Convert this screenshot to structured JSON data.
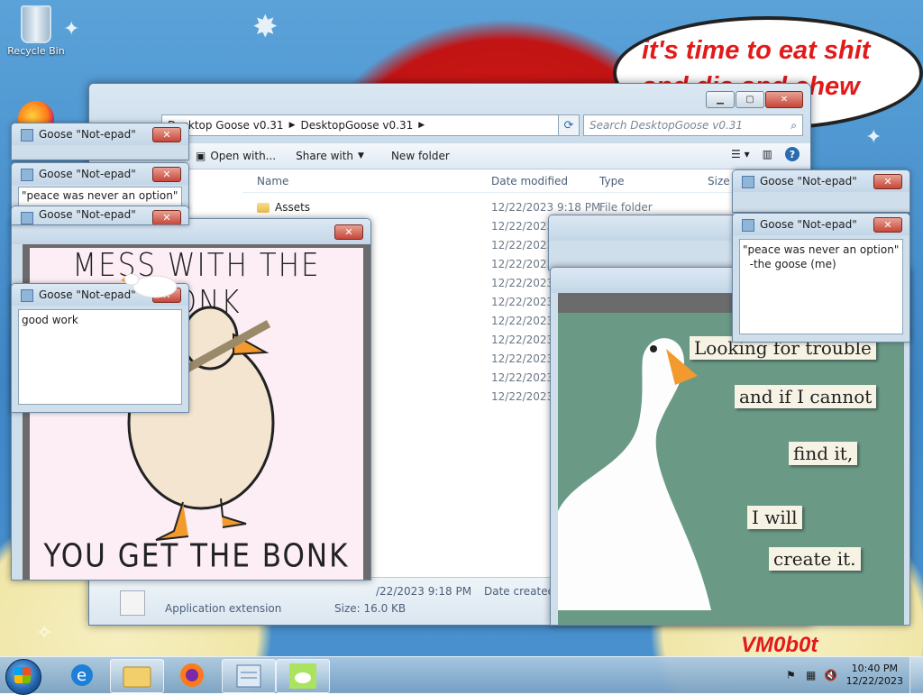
{
  "desktop": {
    "recycle_bin_label": "Recycle Bin",
    "speech_bubble_text": "it's time to eat shit and die and chew",
    "signature": "VM0b0t"
  },
  "explorer": {
    "breadcrumb": [
      "Desktop Goose v0.31",
      "DesktopGoose v0.31"
    ],
    "search_placeholder": "Search DesktopGoose v0.31",
    "toolbar": {
      "open_with": "Open with...",
      "share_with": "Share with",
      "new_folder": "New folder"
    },
    "columns": {
      "name": "Name",
      "date_modified": "Date modified",
      "type": "Type",
      "size": "Size"
    },
    "rows": [
      {
        "name": "Assets",
        "date": "12/22/2023 9:18 PM",
        "type": "File folder"
      },
      {
        "name": "",
        "date": "12/22/2023 9",
        "type": ""
      },
      {
        "name": "",
        "date": "12/22/2023 9",
        "type": ""
      },
      {
        "name": "",
        "date": "12/22/2023 9",
        "type": ""
      },
      {
        "name": "",
        "date": "12/22/2023 9",
        "type": ""
      },
      {
        "name": "",
        "date": "12/22/2023 9",
        "type": ""
      },
      {
        "name": "",
        "date": "12/22/2023 9",
        "type": ""
      },
      {
        "name": "",
        "date": "12/22/2023 9",
        "type": ""
      },
      {
        "name": "",
        "date": "12/22/2023 9",
        "type": ""
      },
      {
        "name": "",
        "date": "12/22/2023 9",
        "type": ""
      },
      {
        "name": "",
        "date": "12/22/2023 9",
        "type": ""
      }
    ],
    "status": {
      "modified_tail": "/22/2023 9:18 PM",
      "date_created_label": "Date created:",
      "file_type": "Application extension",
      "size": "Size: 16.0 KB"
    }
  },
  "notepads": {
    "title": "Goose \"Not-epad\"",
    "top_peek_title": "Goose \"Not-epad\"",
    "peace_left": "\"peace was never an option\"",
    "good_work": "good work",
    "peace_right": "\"peace was never an option\"\n  -the goose (me)"
  },
  "honk_image": {
    "line1": "MESS WITH THE HONK",
    "line2": "YOU GET THE BONK"
  },
  "trouble_image": {
    "notes": [
      "Looking for trouble",
      "and if I cannot",
      "find it,",
      "I will",
      "create it."
    ]
  },
  "taskbar": {
    "time": "10:40 PM",
    "date": "12/22/2023"
  },
  "colors": {
    "speech_red": "#e21a1a",
    "close_red": "#c6463a",
    "taskbar": "#8fb5d5"
  }
}
